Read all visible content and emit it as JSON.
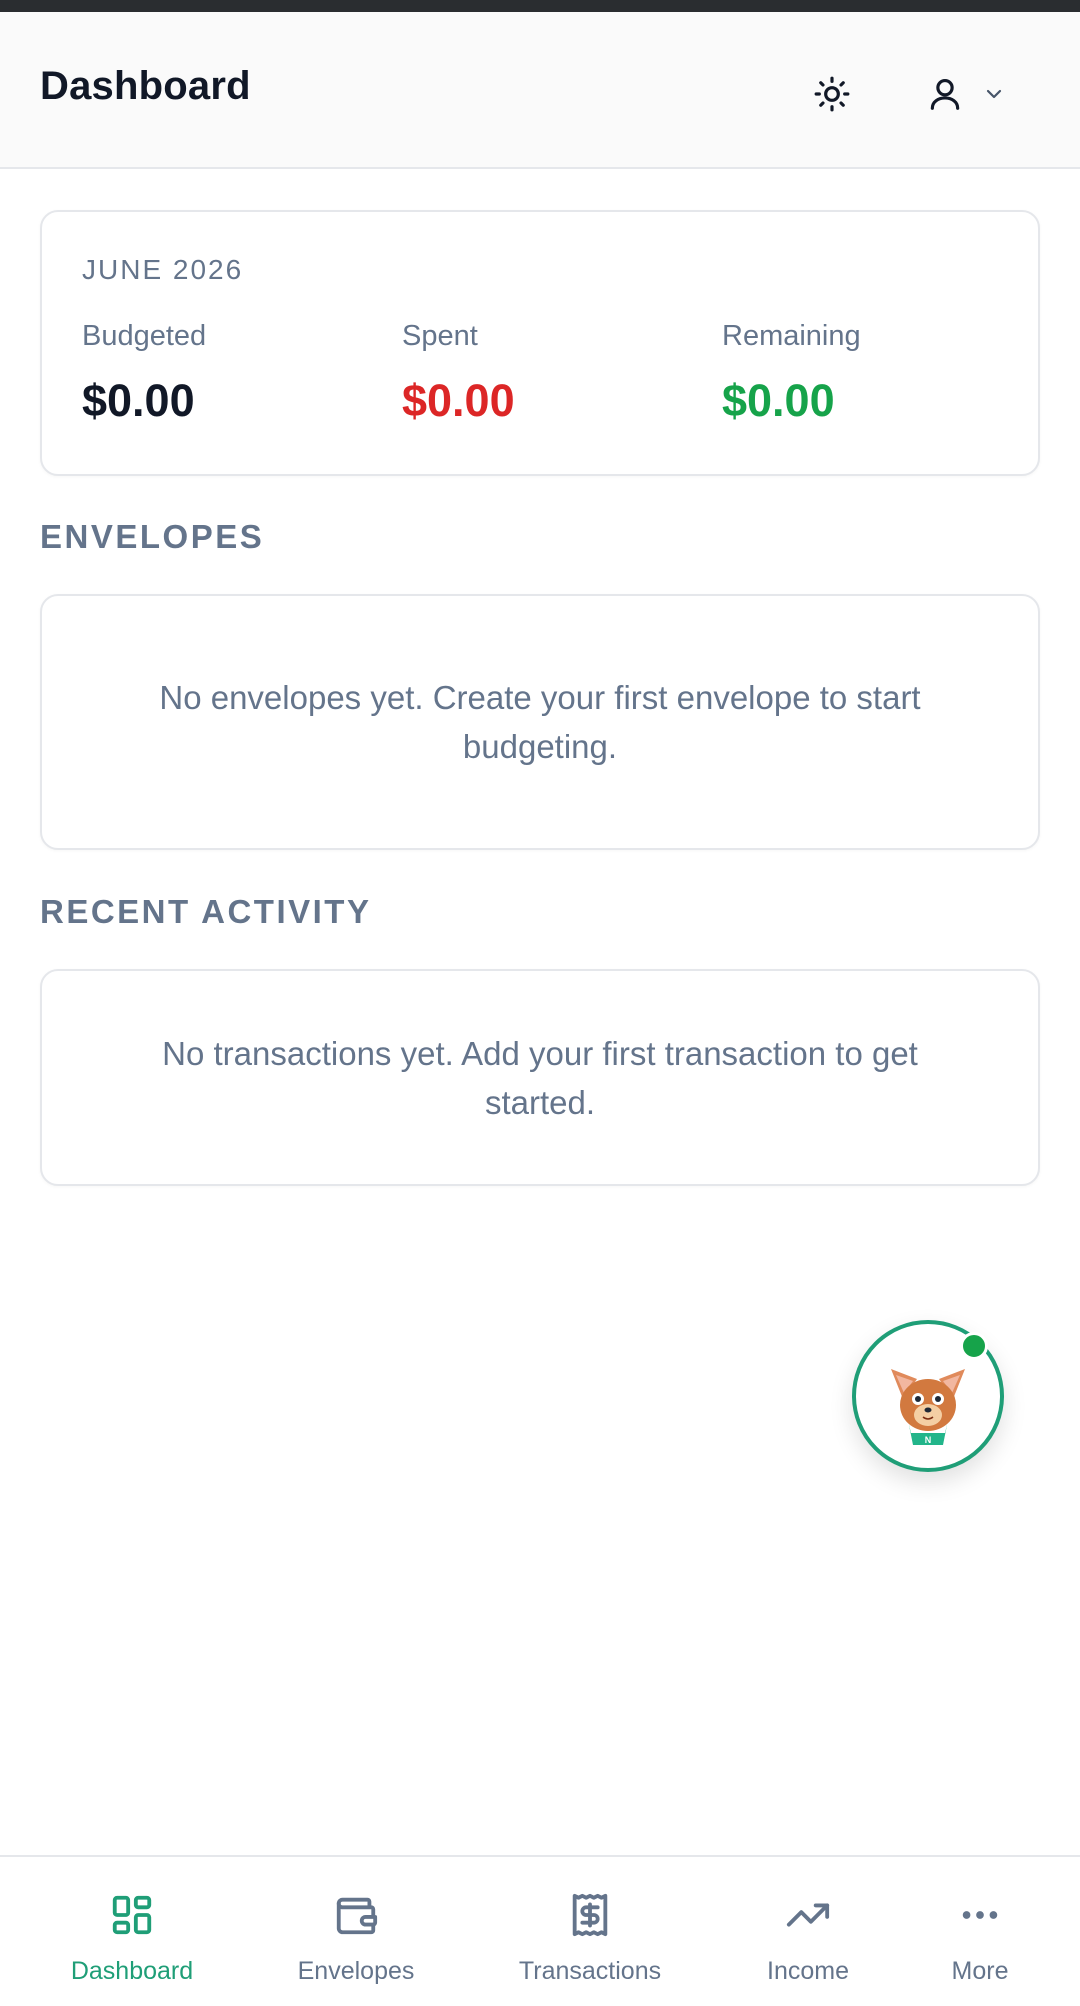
{
  "header": {
    "title": "Dashboard",
    "theme_icon": "sun-icon",
    "user_icon": "user-icon",
    "chevron_icon": "chevron-down-icon"
  },
  "summary": {
    "month": "JUNE 2026",
    "budgeted": {
      "label": "Budgeted",
      "value": "$0.00",
      "color": "#111827"
    },
    "spent": {
      "label": "Spent",
      "value": "$0.00",
      "color": "#dc2626"
    },
    "remaining": {
      "label": "Remaining",
      "value": "$0.00",
      "color": "#16a34a"
    }
  },
  "envelopes": {
    "heading": "ENVELOPES",
    "empty_text": "No envelopes yet. Create your first envelope to start budgeting."
  },
  "recent_activity": {
    "heading": "RECENT ACTIVITY",
    "empty_text": "No transactions yet. Add your first transaction to get started."
  },
  "assistant": {
    "icon": "fox-mascot-icon",
    "badge_letter": "N",
    "status_color": "#16a34a"
  },
  "bottom_nav": {
    "items": [
      {
        "label": "Dashboard",
        "icon": "dashboard-grid-icon",
        "active": true
      },
      {
        "label": "Envelopes",
        "icon": "wallet-icon",
        "active": false
      },
      {
        "label": "Transactions",
        "icon": "receipt-dollar-icon",
        "active": false
      },
      {
        "label": "Income",
        "icon": "trending-up-icon",
        "active": false
      },
      {
        "label": "More",
        "icon": "more-dots-icon",
        "active": false
      }
    ]
  },
  "colors": {
    "accent": "#1f9e77",
    "muted_text": "#64748b",
    "border": "#e5e7eb"
  }
}
